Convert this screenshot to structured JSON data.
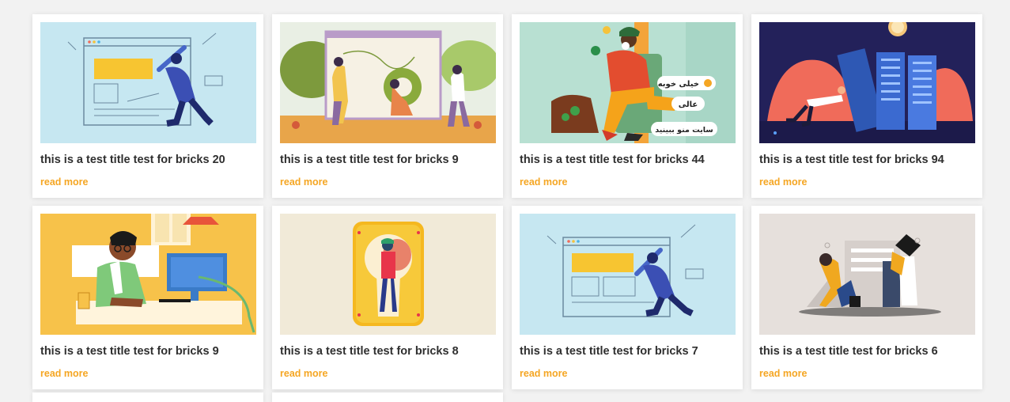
{
  "posts": [
    {
      "title": "this is a test title test for bricks 20",
      "more": "read more",
      "illustration": "designer-wireframe-illustration"
    },
    {
      "title": "this is a test title test for bricks 9",
      "more": "read more",
      "illustration": "team-whiteboard-illustration"
    },
    {
      "title": "this is a test title test for bricks 44",
      "more": "read more",
      "illustration": "man-armchair-illustration",
      "overlay": [
        "خیلی خوبه",
        "عالی",
        "سایت منو ببینید"
      ]
    },
    {
      "title": "this is a test title test for bricks 94",
      "more": "read more",
      "illustration": "server-racks-illustration"
    },
    {
      "title": "this is a test title test for bricks 9",
      "more": "read more",
      "illustration": "man-computer-desk-illustration"
    },
    {
      "title": "this is a test title test for bricks 8",
      "more": "read more",
      "illustration": "keyhole-illustration"
    },
    {
      "title": "this is a test title test for bricks 7",
      "more": "read more",
      "illustration": "designer-wireframe-illustration"
    },
    {
      "title": "this is a test title test for bricks 6",
      "more": "read more",
      "illustration": "people-papers-illustration"
    }
  ],
  "colors": {
    "accent": "#f5a623",
    "title": "#2f2f2f",
    "card": "#ffffff",
    "page": "#f2f2f2"
  }
}
